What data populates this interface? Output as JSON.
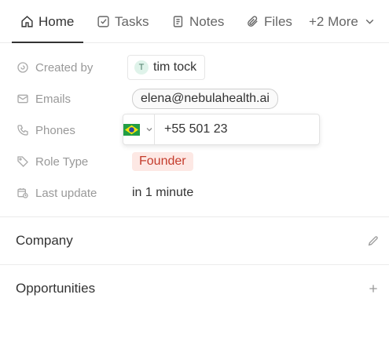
{
  "tabs": [
    {
      "label": "Home",
      "icon": "home-icon",
      "active": true
    },
    {
      "label": "Tasks",
      "icon": "checkbox-icon"
    },
    {
      "label": "Notes",
      "icon": "notes-icon"
    },
    {
      "label": "Files",
      "icon": "paperclip-icon"
    },
    {
      "label": "+2 More",
      "icon": "chevron-down-icon"
    }
  ],
  "fields": {
    "created_by": {
      "label": "Created by",
      "avatar_initial": "T",
      "value": "tim tock"
    },
    "emails": {
      "label": "Emails",
      "value": "elena@nebulahealth.ai"
    },
    "phones": {
      "label": "Phones",
      "country_flag": "brazil-flag-icon",
      "input_value": "+55 501 23"
    },
    "role_type": {
      "label": "Role Type",
      "value": "Founder"
    },
    "last_update": {
      "label": "Last update",
      "value": "in 1 minute"
    }
  },
  "sections": {
    "company": {
      "title": "Company",
      "action_icon": "pencil-icon"
    },
    "opportunities": {
      "title": "Opportunities",
      "action_icon": "plus-icon"
    }
  },
  "colors": {
    "role_chip_bg": "#fde8e4",
    "role_chip_text": "#c43c2c",
    "avatar_bg": "#dff3ea"
  }
}
